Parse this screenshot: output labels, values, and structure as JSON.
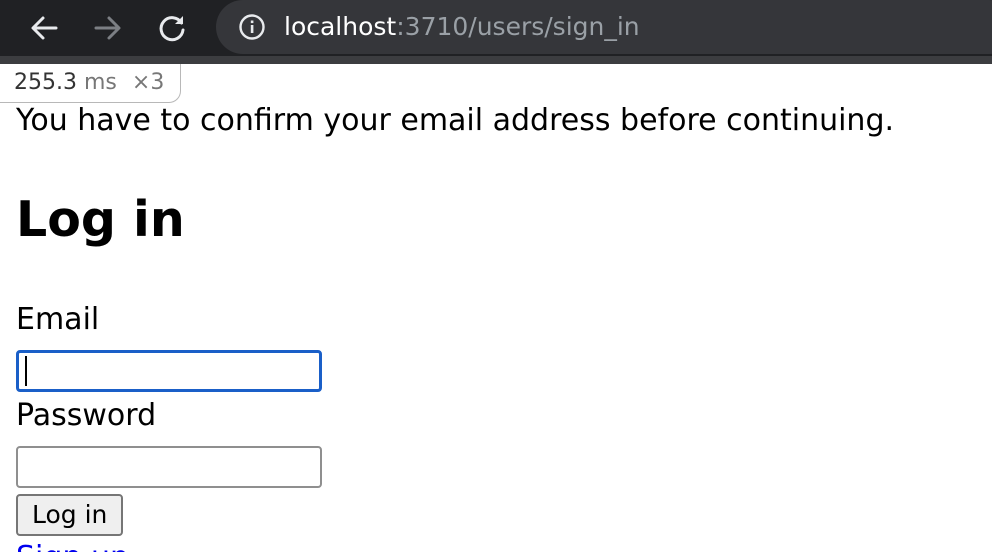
{
  "browser": {
    "url_host": "localhost",
    "url_rest": ":3710/users/sign_in",
    "icons": {
      "back": "back-arrow-icon",
      "forward": "forward-arrow-icon",
      "reload": "reload-icon",
      "info": "info-icon"
    }
  },
  "profiler": {
    "time": "255.3",
    "unit": "ms",
    "count": "×3"
  },
  "page": {
    "notice": "You have to confirm your email address before continuing.",
    "title": "Log in",
    "email_label": "Email",
    "email_value": "",
    "password_label": "Password",
    "password_value": "",
    "submit_label": "Log in",
    "signup_link": "Sign up"
  },
  "colors": {
    "toolbar_bg": "#202124",
    "omnibox_bg": "#35363a",
    "focus_ring": "#1a5fc8",
    "link": "#0000ee"
  }
}
